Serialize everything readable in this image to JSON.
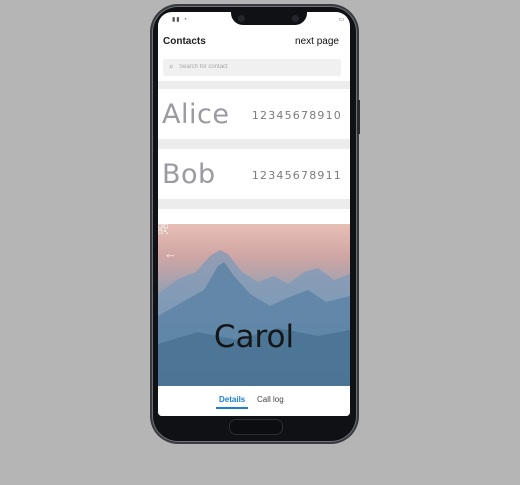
{
  "app": {
    "title": "Contacts",
    "next_page_label": "next page"
  },
  "search": {
    "placeholder": "Search for contact"
  },
  "contacts": [
    {
      "name": "Alice",
      "phone": "12345678910"
    },
    {
      "name": "Bob",
      "phone": "12345678911"
    }
  ],
  "detail": {
    "name": "Carol"
  },
  "tabs": [
    {
      "label": "Details",
      "active": true
    },
    {
      "label": "Call log",
      "active": false
    }
  ],
  "colors": {
    "accent": "#1a7fd6",
    "name_text": "#9a9aa2"
  },
  "icons": {
    "back": "arrow-left",
    "qr": "qr-code",
    "search": "magnifier"
  }
}
